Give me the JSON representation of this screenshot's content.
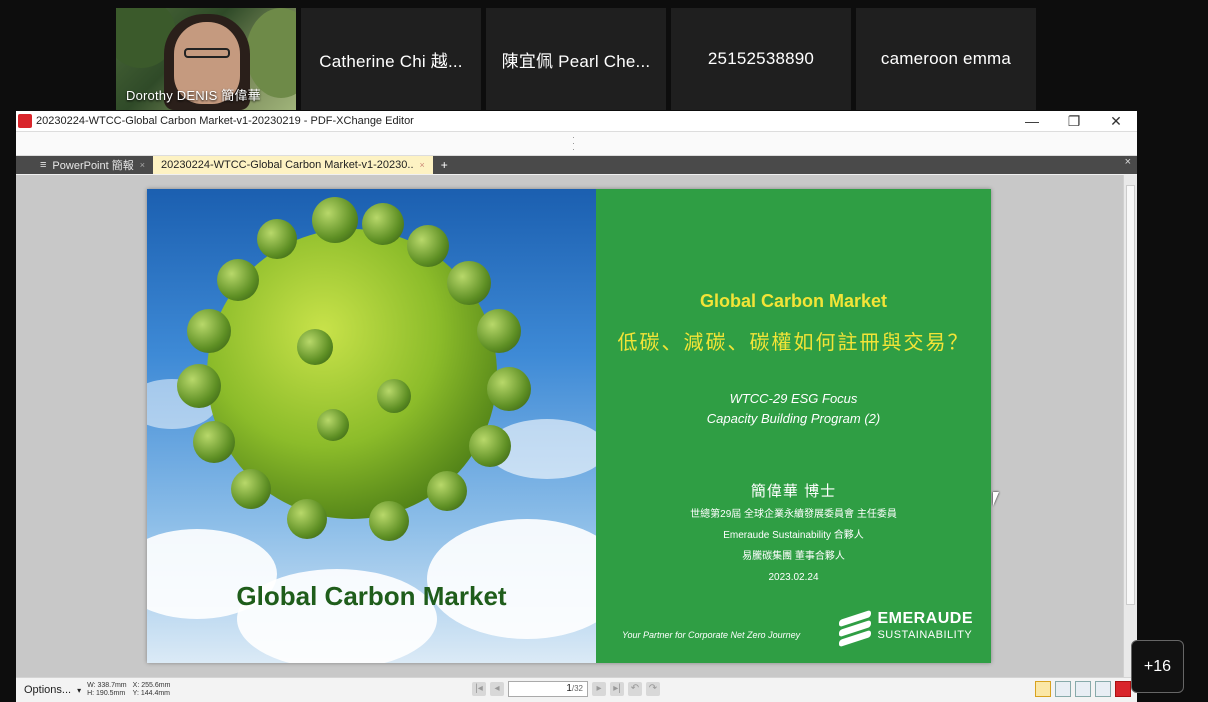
{
  "participants": [
    {
      "name": "Dorothy DENIS 簡偉華",
      "has_video": true
    },
    {
      "name": "Catherine Chi 越..."
    },
    {
      "name": "陳宜佩 Pearl Che..."
    },
    {
      "name": "25152538890"
    },
    {
      "name": "cameroon emma"
    }
  ],
  "more_participants": "+16",
  "window": {
    "title": "20230224-WTCC-Global Carbon Market-v1-20230219 - PDF-XChange Editor",
    "controls": {
      "minimize": "—",
      "restore": "❐",
      "close": "✕"
    }
  },
  "tabs": [
    {
      "label": "PowerPoint 簡報",
      "active": false
    },
    {
      "label": "20230224-WTCC-Global Carbon Market-v1-20230..",
      "active": true
    }
  ],
  "slide": {
    "left_caption": "Global Carbon Market",
    "title": "Global Carbon Market",
    "subtitle": "低碳、減碳、碳權如何註冊與交易？",
    "program_line1": "WTCC-29 ESG Focus",
    "program_line2": "Capacity Building Program (2)",
    "speaker": "簡偉華 博士",
    "role1": "世總第29屆 全球企業永續發展委員會 主任委員",
    "role2": "Emeraude Sustainability 合夥人",
    "role3": "易騰碳集團 董事合夥人",
    "date": "2023.02.24",
    "tagline": "Your Partner for Corporate Net Zero Journey",
    "logo_word1": "EMERAUDE",
    "logo_word2": "SUSTAINABILITY",
    "colors": {
      "green": "#2f9e44",
      "yellow": "#f2e437"
    }
  },
  "statusbar": {
    "options": "Options...",
    "dims_w": "W: 338.7mm",
    "dims_h": "H: 190.5mm",
    "pos_x": "X: 255.6mm",
    "pos_y": "Y: 144.4mm",
    "page_current": "1",
    "page_total": "/32"
  }
}
